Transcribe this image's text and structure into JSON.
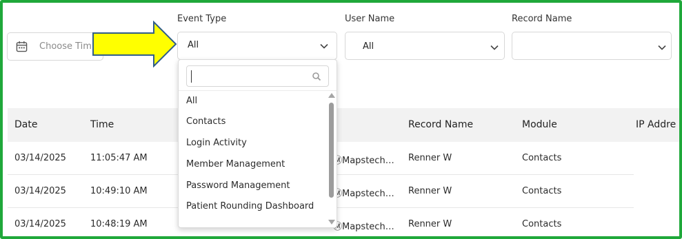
{
  "filters": {
    "date_placeholder": "Choose Tim",
    "event_type": {
      "label": "Event Type",
      "value": "All"
    },
    "user_name": {
      "label": "User Name",
      "value": "All"
    },
    "record_name": {
      "label": "Record Name",
      "value": ""
    }
  },
  "dropdown": {
    "search_value": "",
    "options": [
      "All",
      "Contacts",
      "Login Activity",
      "Member Management",
      "Password Management",
      "Patient Rounding Dashboard"
    ]
  },
  "table": {
    "headers": [
      "Date",
      "Time",
      "Record Name",
      "Module",
      "IP Addre"
    ],
    "rows": [
      {
        "date": "03/14/2025",
        "time": "11:05:47 AM",
        "user": "ⓂMapstech…",
        "record": "Renner W",
        "module": "Contacts"
      },
      {
        "date": "03/14/2025",
        "time": "10:49:10 AM",
        "user": "ⓂMapstech…",
        "record": "Renner W",
        "module": "Contacts"
      },
      {
        "date": "03/14/2025",
        "time": "10:48:19 AM",
        "user": "ⓂMapstech…",
        "record": "Renner W",
        "module": "Contacts"
      }
    ]
  },
  "colors": {
    "frame": "#1fa83a",
    "arrow_fill": "#ffff00",
    "arrow_stroke": "#2f5d8a",
    "header_bg": "#f2f2f2"
  },
  "icons": [
    "calendar-icon",
    "chevron-down-icon",
    "search-icon",
    "callout-arrow"
  ]
}
